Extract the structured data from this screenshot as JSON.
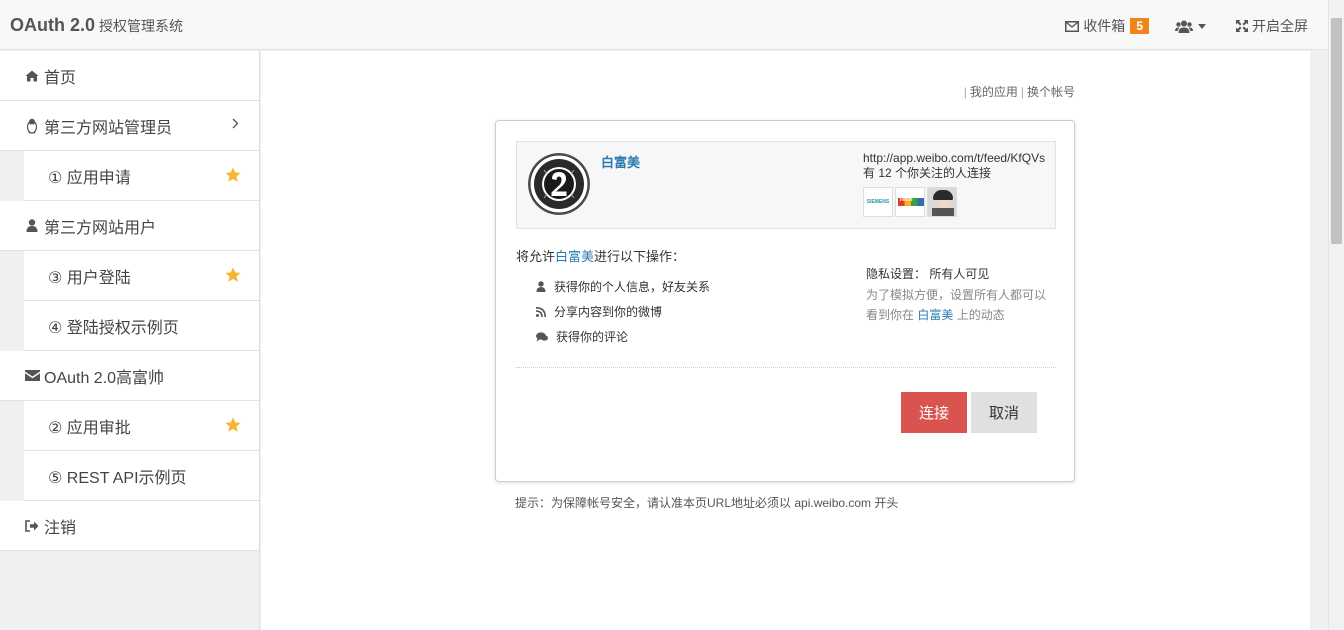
{
  "app": {
    "brand_main": "OAuth 2.0",
    "brand_sub": "授权管理系统"
  },
  "header": {
    "inbox_label": "收件箱",
    "inbox_count": "5",
    "fullscreen_label": "开启全屏"
  },
  "sidebar": {
    "home": "首页",
    "group1": "第三方网站管理员",
    "group1_items": [
      "① 应用申请"
    ],
    "group2": "第三方网站用户",
    "group2_items": [
      "③ 用户登陆",
      "④ 登陆授权示例页"
    ],
    "group3": "OAuth 2.0高富帅",
    "group3_items": [
      "② 应用审批",
      "⑤ REST API示例页"
    ],
    "logout": "注销"
  },
  "toplinks": {
    "sep": "|",
    "my_apps": "我的应用",
    "switch_account": "换个帐号"
  },
  "auth": {
    "app_name": "白富美",
    "app_url": "http://app.weibo.com/t/feed/KfQVs",
    "follow_text": "有 12 个你关注的人连接",
    "avatar_labels": [
      "SIEMENS",
      "Tech"
    ],
    "perm_prefix": "将允许",
    "perm_app": "白富美",
    "perm_suffix": "进行以下操作：",
    "permissions": [
      "获得你的个人信息，好友关系",
      "分享内容到你的微博",
      "获得你的评论"
    ],
    "privacy_label": "隐私设置：",
    "privacy_value": "所有人可见",
    "privacy_desc_1": "为了模拟方便，设置所有人都可以看到你在",
    "privacy_app": "白富美",
    "privacy_desc_2": "上的动态",
    "connect_label": "连接",
    "cancel_label": "取消"
  },
  "tip": "提示：为保障帐号安全，请认准本页URL地址必须以 api.weibo.com 开头",
  "colors": {
    "link": "#2a7ab0",
    "badge": "#f0851c",
    "primary_button": "#d9534f",
    "star": "#f5b731"
  }
}
